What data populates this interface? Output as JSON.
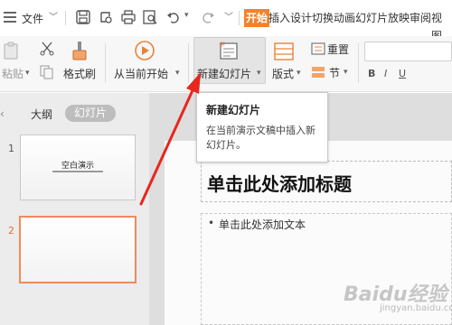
{
  "titlebar": {
    "file_label": "文件",
    "tabs": [
      "开始",
      "插入",
      "设计",
      "切换",
      "动画",
      "幻灯片放映",
      "审阅",
      "视图"
    ]
  },
  "ribbon": {
    "paste_label": "粘贴",
    "format_painter_label": "格式刷",
    "play_from_current_label": "从当前开始",
    "new_slide_label": "新建幻灯片",
    "layout_label": "版式",
    "reset_label": "重置",
    "section_label": "节"
  },
  "tooltip": {
    "title": "新建幻灯片",
    "description": "在当前演示文稿中插入新幻灯片。"
  },
  "left_panel": {
    "tab_outline": "大纲",
    "tab_slides": "幻灯片",
    "slides": [
      {
        "number": "1",
        "title": "空白演示"
      },
      {
        "number": "2"
      }
    ]
  },
  "slide": {
    "title_placeholder": "单击此处添加标题",
    "body_bullet": "•",
    "body_placeholder": "单击此处添加文本"
  },
  "watermark": {
    "logo_text": "Baidu经验",
    "sub_text": "jingyan.baidu.com"
  },
  "colors": {
    "accent": "#f3822c",
    "selected_slide_border": "#f08a5d",
    "annotation_arrow": "#e8271d"
  }
}
